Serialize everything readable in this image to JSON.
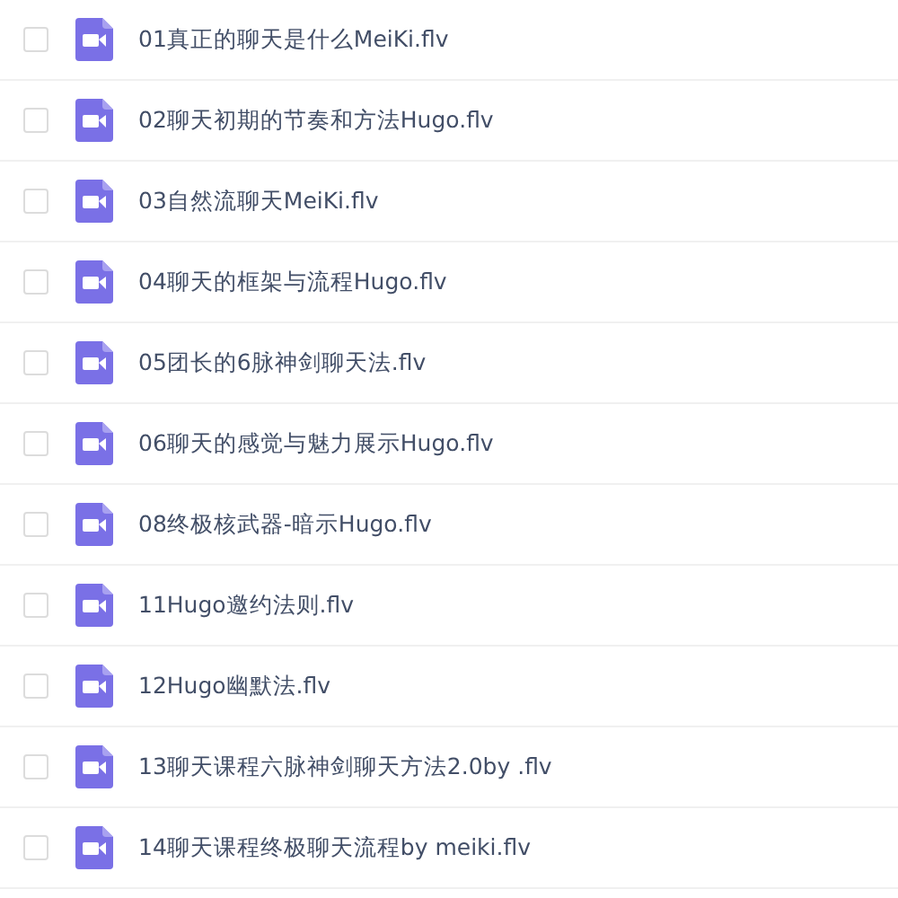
{
  "files": [
    {
      "name": "01真正的聊天是什么MeiKi.flv",
      "checked": false
    },
    {
      "name": "02聊天初期的节奏和方法Hugo.flv",
      "checked": false
    },
    {
      "name": "03自然流聊天MeiKi.flv",
      "checked": false
    },
    {
      "name": "04聊天的框架与流程Hugo.flv",
      "checked": false
    },
    {
      "name": "05团长的6脉神剑聊天法.flv",
      "checked": false
    },
    {
      "name": "06聊天的感觉与魅力展示Hugo.flv",
      "checked": false
    },
    {
      "name": "08终极核武器-暗示Hugo.flv",
      "checked": false
    },
    {
      "name": "11Hugo邀约法则.flv",
      "checked": false
    },
    {
      "name": "12Hugo幽默法.flv",
      "checked": false
    },
    {
      "name": "13聊天课程六脉神剑聊天方法2.0by .flv",
      "checked": false
    },
    {
      "name": "14聊天课程终极聊天流程by meiki.flv",
      "checked": false
    }
  ]
}
